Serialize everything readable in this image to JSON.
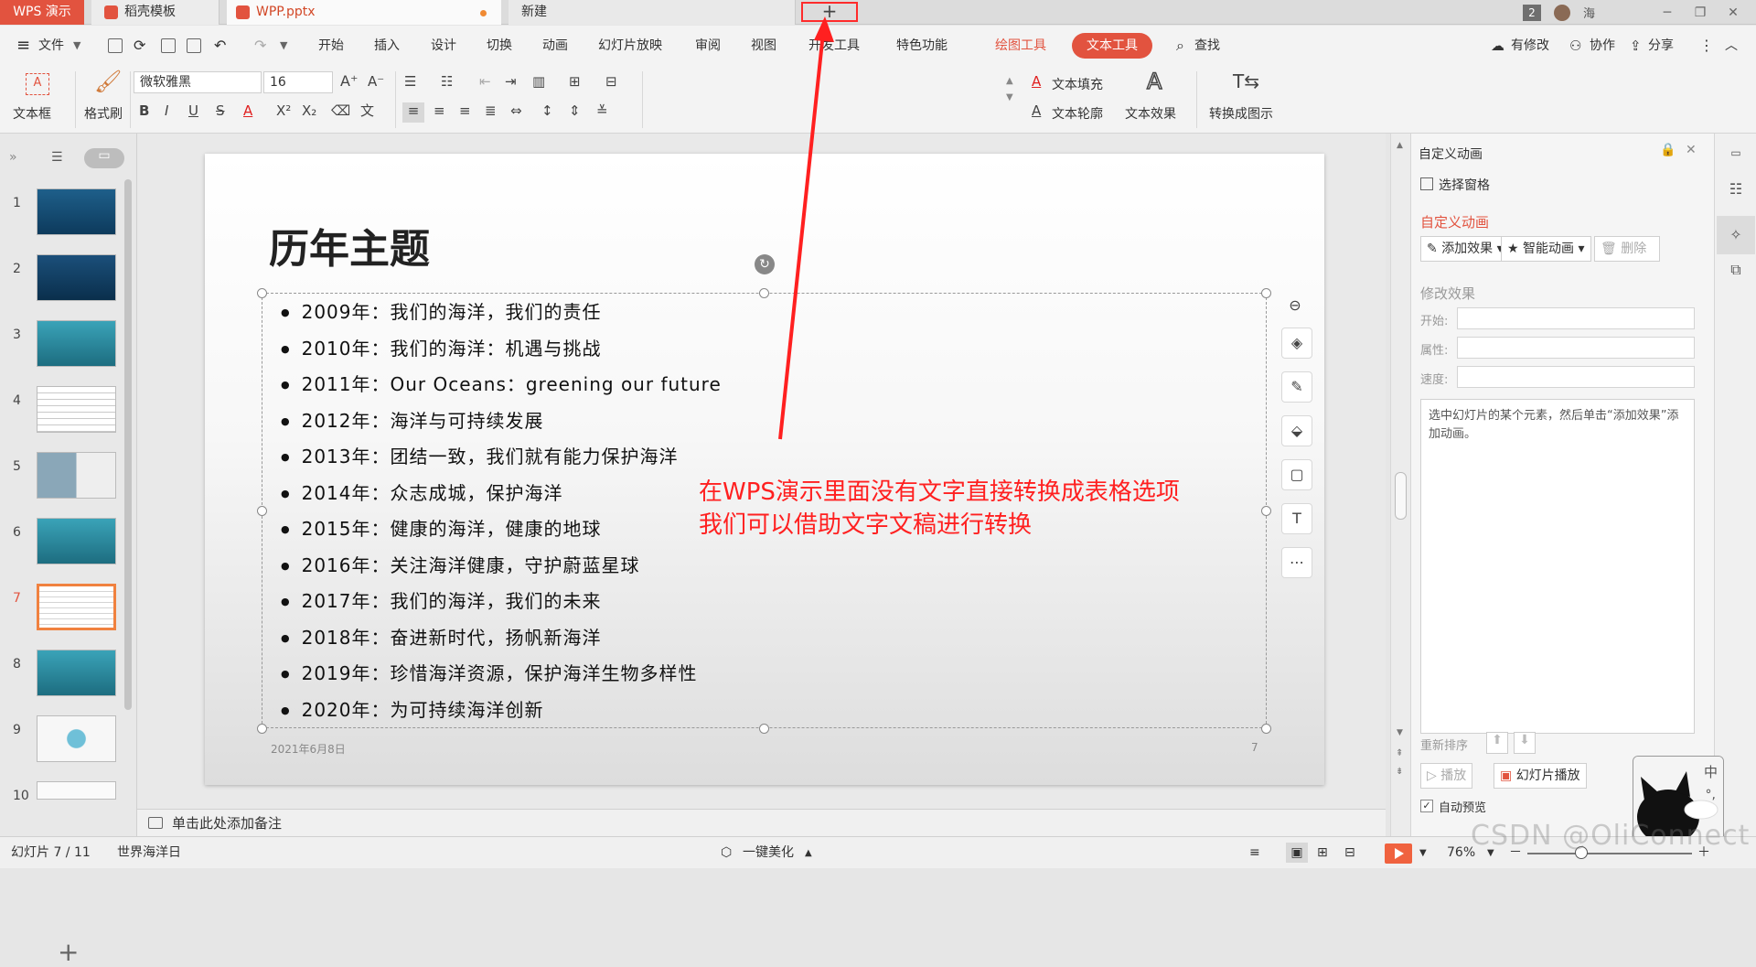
{
  "tabbar": {
    "app_tab": "WPS 演示",
    "docer_tab": "稻壳模板",
    "file_tab": "WPP.pptx",
    "new_tab": "新建",
    "add_tab": "+",
    "window_count": "2",
    "user_name": "海"
  },
  "menubar": {
    "file": "文件",
    "tabs": [
      "开始",
      "插入",
      "设计",
      "切换",
      "动画",
      "幻灯片放映",
      "审阅",
      "视图",
      "开发工具",
      "特色功能"
    ],
    "drawing_tools": "绘图工具",
    "text_tools": "文本工具",
    "search": "查找",
    "modified": "有修改",
    "collaborate": "协作",
    "share": "分享"
  },
  "ribbon": {
    "textbox": "文本框",
    "format_painter": "格式刷",
    "font_name": "微软雅黑",
    "font_size": "16",
    "text_fill": "文本填充",
    "text_outline": "文本轮廓",
    "text_effect": "文本效果",
    "convert_to_graphic": "转换成图示"
  },
  "slides_panel": {
    "numbers": [
      "1",
      "2",
      "3",
      "4",
      "5",
      "6",
      "7",
      "8",
      "9",
      "10"
    ],
    "add_label": "+"
  },
  "slide": {
    "title": "历年主题",
    "bullets": [
      "2009年：我们的海洋，我们的责任",
      "2010年：我们的海洋：机遇与挑战",
      "2011年：Our Oceans：greening our future",
      "2012年：海洋与可持续发展",
      "2013年：团结一致，我们就有能力保护海洋",
      "2014年：众志成城，保护海洋",
      "2015年：健康的海洋，健康的地球",
      "2016年：关注海洋健康，守护蔚蓝星球",
      "2017年：我们的海洋，我们的未来",
      "2018年：奋进新时代，扬帆新海洋",
      "2019年：珍惜海洋资源，保护海洋生物多样性",
      "2020年：为可持续海洋创新"
    ],
    "date": "2021年6月8日",
    "page_number": "7"
  },
  "annotation": {
    "line1": "在WPS演示里面没有文字直接转换成表格选项",
    "line2": "我们可以借助文字文稿进行转换"
  },
  "notes": {
    "placeholder": "单击此处添加备注"
  },
  "taskpane": {
    "header": "自定义动画",
    "selection_pane": "选择窗格",
    "section_title": "自定义动画",
    "add_effect": "添加效果",
    "smart_anim": "智能动画",
    "delete": "删除",
    "modify_effect": "修改效果",
    "start_label": "开始:",
    "property_label": "属性:",
    "speed_label": "速度:",
    "description": "选中幻灯片的某个元素，然后单击“添加效果”添加动画。",
    "reorder": "重新排序",
    "play": "播放",
    "slideshow": "幻灯片播放",
    "auto_preview": "自动预览"
  },
  "status": {
    "slide_counter": "幻灯片 7 / 11",
    "theme": "世界海洋日",
    "beautify": "一键美化",
    "zoom": "76%"
  },
  "watermark": "CSDN @OliConnect",
  "colors": {
    "accent": "#e2533f",
    "annotation": "#ff2020"
  }
}
